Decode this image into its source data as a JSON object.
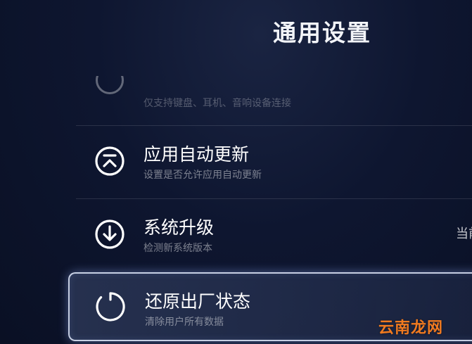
{
  "header": {
    "title": "通用设置"
  },
  "partial_item": {
    "subtitle": "仅支持键盘、耳机、音响设备连接",
    "icon": "circle-icon"
  },
  "items": [
    {
      "title": "应用自动更新",
      "subtitle": "设置是否允许应用自动更新",
      "icon": "chevron-up-circle-icon"
    },
    {
      "title": "系统升级",
      "subtitle": "检测新系统版本",
      "value": "当前",
      "icon": "download-circle-icon"
    },
    {
      "title": "还原出厂状态",
      "subtitle": "清除用户所有数据",
      "icon": "restore-circle-icon",
      "selected": true
    }
  ],
  "watermark": {
    "text": "云南龙网"
  },
  "colors": {
    "background": "#0e1630",
    "text": "#ffffff",
    "subtext": "#8a90a0",
    "selection_border": "#e6eeff",
    "watermark": "#f07a20"
  }
}
